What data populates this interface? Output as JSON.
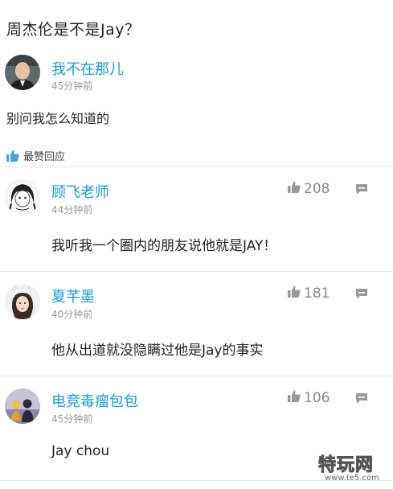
{
  "question": {
    "title": "周杰伦是不是Jay？"
  },
  "post": {
    "author": "我不在那儿",
    "time": "45分钟前",
    "text": "别问我怎么知道的"
  },
  "section": {
    "label": "最赞回应"
  },
  "comments": [
    {
      "author": "顾飞老师",
      "time": "44分钟前",
      "likes": "208",
      "text": "我听我一个圈内的朋友说他就是JAY！"
    },
    {
      "author": "夏芊墨",
      "time": "40分钟前",
      "likes": "181",
      "text": "他从出道就没隐瞒过他是Jay的事实"
    },
    {
      "author": "电竞毒瘤包包",
      "time": "45分钟前",
      "likes": "106",
      "text": "Jay chou"
    }
  ],
  "watermark": {
    "brand": "特玩网",
    "url": "www.te5.com"
  },
  "colors": {
    "accent": "#1a9ccc",
    "muted": "#999999",
    "thumb": "#4aa3cf"
  }
}
